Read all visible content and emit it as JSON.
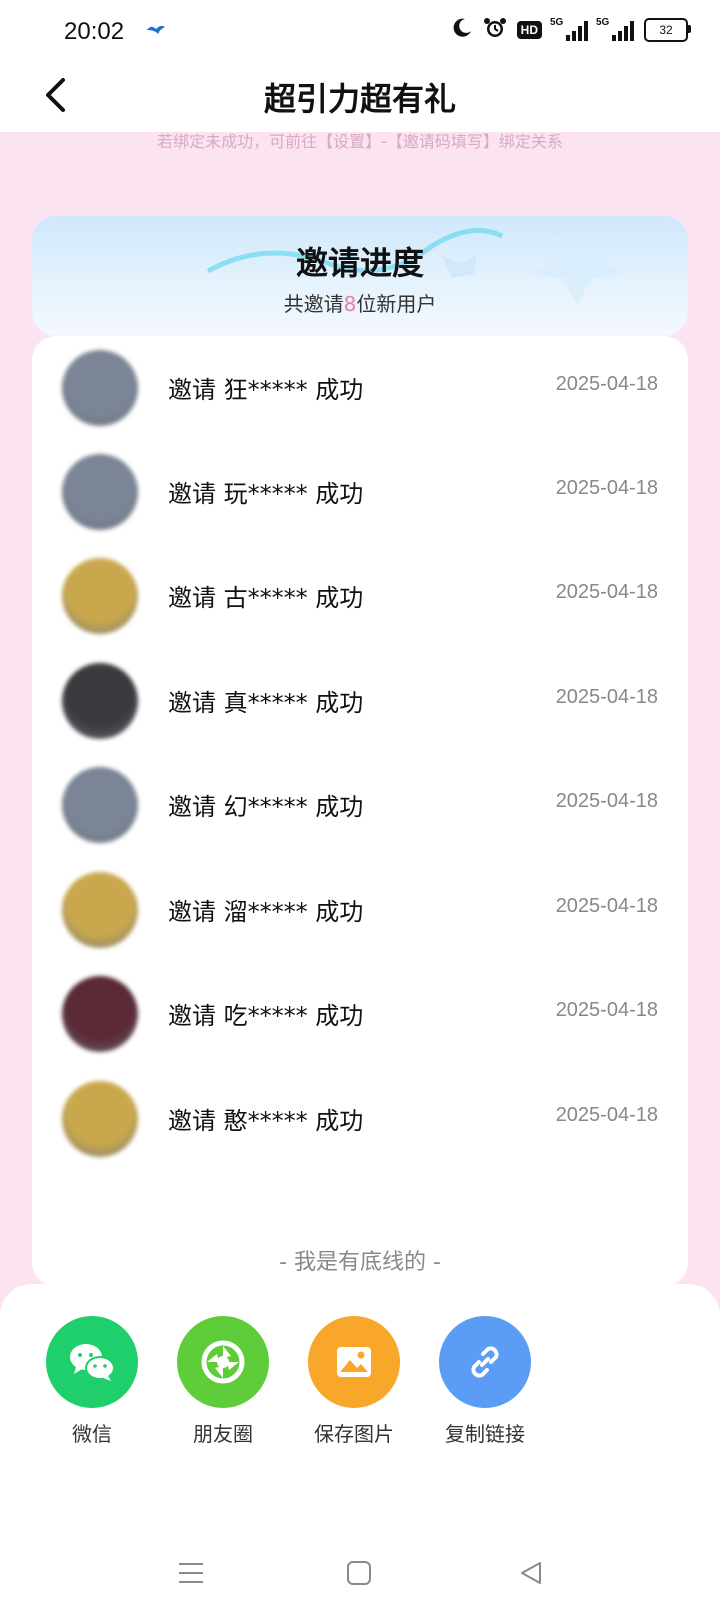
{
  "status_bar": {
    "time": "20:02",
    "hd_label": "HD",
    "signal1_label": "5G",
    "signal2_label": "5G",
    "battery": "32"
  },
  "header": {
    "title": "超引力超有礼"
  },
  "hint": "若绑定未成功，可前往【设置】-【邀请码填写】绑定关系",
  "progress": {
    "title": "邀请进度",
    "sub_prefix": "共邀请",
    "count": "8",
    "sub_suffix": "位新用户"
  },
  "invites": [
    {
      "text": "邀请 狂***** 成功",
      "date": "2025-04-18",
      "avatar_color": "#7b8595"
    },
    {
      "text": "邀请 玩***** 成功",
      "date": "2025-04-18",
      "avatar_color": "#7b8595"
    },
    {
      "text": "邀请 古***** 成功",
      "date": "2025-04-18",
      "avatar_color": "#c9a84d"
    },
    {
      "text": "邀请 真***** 成功",
      "date": "2025-04-18",
      "avatar_color": "#3b3b3f"
    },
    {
      "text": "邀请 幻***** 成功",
      "date": "2025-04-18",
      "avatar_color": "#7b8595"
    },
    {
      "text": "邀请 溜***** 成功",
      "date": "2025-04-18",
      "avatar_color": "#c9a84d"
    },
    {
      "text": "邀请 吃***** 成功",
      "date": "2025-04-18",
      "avatar_color": "#5a2a35"
    },
    {
      "text": "邀请 憨***** 成功",
      "date": "2025-04-18",
      "avatar_color": "#c9a84d"
    }
  ],
  "footer_note": "- 我是有底线的 -",
  "share": [
    {
      "label": "微信",
      "icon": "wechat-icon",
      "color": "#1fcf6b"
    },
    {
      "label": "朋友圈",
      "icon": "moments-icon",
      "color": "#5fcd3a"
    },
    {
      "label": "保存图片",
      "icon": "save-image-icon",
      "color": "#f9a72b"
    },
    {
      "label": "复制链接",
      "icon": "link-icon",
      "color": "#5b9cf5"
    }
  ]
}
